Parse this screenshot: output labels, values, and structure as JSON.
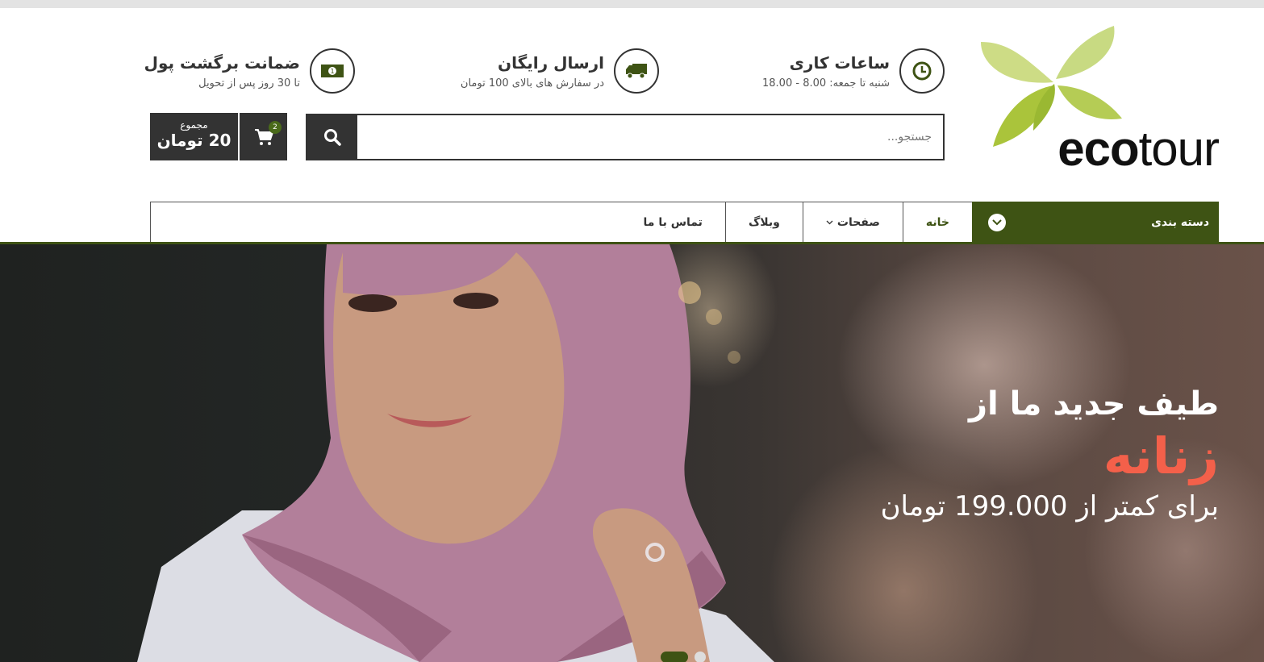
{
  "brand": {
    "logo_bold": "eco",
    "logo_light": "tour"
  },
  "info": {
    "hours": {
      "title": "ساعات کاری",
      "sub": "شنبه تا جمعه: 8.00 - 18.00",
      "icon": "clock-icon"
    },
    "shipping": {
      "title": "ارسال رایگان",
      "sub": "در سفارش های بالای 100 تومان",
      "icon": "truck-icon"
    },
    "guarantee": {
      "title": "ضمانت برگشت پول",
      "sub": "تا 30 روز پس از تحویل",
      "icon": "money-icon"
    }
  },
  "search": {
    "placeholder": "جستجو..."
  },
  "cart": {
    "count": "2",
    "total_label": "مجموع",
    "total_amount": "20 تومان"
  },
  "nav": {
    "category_label": "دسته بندی",
    "items": [
      "خانه",
      "صفحات",
      "وبلاگ",
      "تماس با ما"
    ]
  },
  "hero": {
    "line1": "طیف جدید ما از",
    "line2": "زنانه",
    "line3": "برای کمتر از 199.000 تومان"
  },
  "colors": {
    "accent": "#3e5314",
    "highlight": "#f4604a",
    "dark": "#333333"
  },
  "slider": {
    "slides": 2,
    "active_index": 0
  }
}
